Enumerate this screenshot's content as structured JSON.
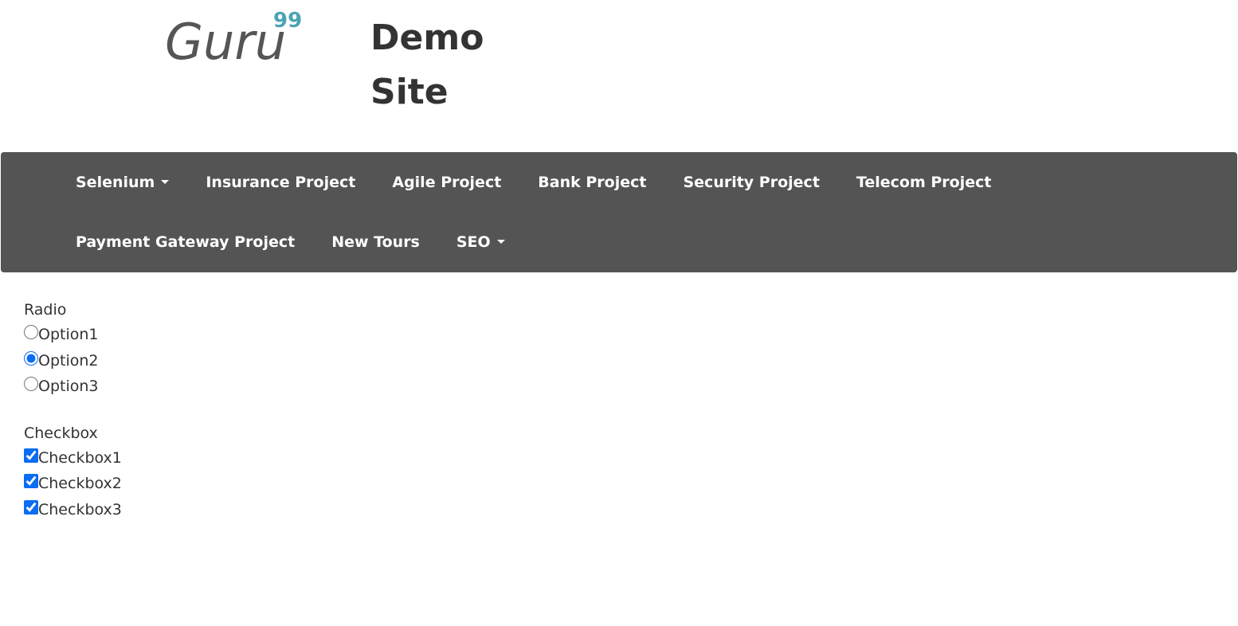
{
  "logo": {
    "text": "Guru",
    "superscript": "99",
    "text_color": "#555555",
    "superscript_color": "#4aa3b5"
  },
  "site_title_line1": "Demo",
  "site_title_line2": "Site",
  "navbar": {
    "background": "#545454",
    "row1": [
      {
        "label": "Selenium",
        "dropdown": true
      },
      {
        "label": "Insurance Project",
        "dropdown": false
      },
      {
        "label": "Agile Project",
        "dropdown": false
      },
      {
        "label": "Bank Project",
        "dropdown": false
      },
      {
        "label": "Security Project",
        "dropdown": false
      },
      {
        "label": "Telecom Project",
        "dropdown": false
      }
    ],
    "row2": [
      {
        "label": "Payment Gateway Project",
        "dropdown": false
      },
      {
        "label": "New Tours",
        "dropdown": false
      },
      {
        "label": "SEO",
        "dropdown": true
      }
    ]
  },
  "radio_group": {
    "label": "Radio",
    "options": [
      {
        "label": "Option1",
        "checked": false
      },
      {
        "label": "Option2",
        "checked": true
      },
      {
        "label": "Option3",
        "checked": false
      }
    ]
  },
  "checkbox_group": {
    "label": "Checkbox",
    "options": [
      {
        "label": "Checkbox1",
        "checked": true
      },
      {
        "label": "Checkbox2",
        "checked": true
      },
      {
        "label": "Checkbox3",
        "checked": true
      }
    ]
  }
}
